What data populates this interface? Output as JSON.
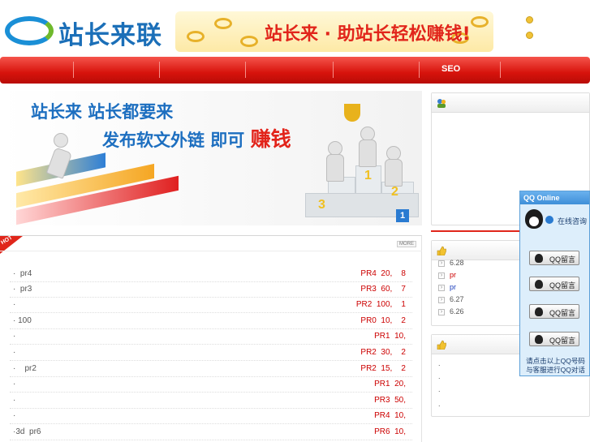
{
  "header": {
    "logo_text": "站长来联盟",
    "banner_text": "站长来 · 助站长轻松赚钱!"
  },
  "nav": {
    "items": [
      "SEO"
    ]
  },
  "hero": {
    "line1": "站长来 站长都要来",
    "line2_prefix": "发布软文外链 即可",
    "line2_highlight": "赚钱",
    "podium_numbers": [
      "1",
      "2",
      "3"
    ],
    "badge": "1"
  },
  "news": {
    "hot_label": "HOT",
    "more_label": "MORE",
    "rows": [
      {
        "left": "·  pr4",
        "right": "PR4  20,    8"
      },
      {
        "left": "·  pr3",
        "right": "PR3  60,    7"
      },
      {
        "left": "·",
        "right": "PR2  100,    1"
      },
      {
        "left": "· 100",
        "right": "PR0  10,    2"
      },
      {
        "left": "·",
        "right": "PR1  10,"
      },
      {
        "left": "·",
        "right": "PR2  30,    2"
      },
      {
        "left": "·    pr2",
        "right": "PR2  15,    2"
      },
      {
        "left": "·",
        "right": "PR1  20,"
      },
      {
        "left": "·",
        "right": "PR3  50,"
      },
      {
        "left": "·",
        "right": "PR4  10,"
      },
      {
        "left": "·3d  pr6",
        "right": "PR6  10,"
      }
    ]
  },
  "right_box2": {
    "items": [
      {
        "text": "6.28",
        "color": "#555555"
      },
      {
        "text": "pr",
        "color": "#cc0000"
      },
      {
        "text": "pr",
        "color": "#1a3dbb"
      },
      {
        "text": "6.27",
        "color": "#555555"
      },
      {
        "text": "6.26",
        "color": "#555555"
      }
    ]
  },
  "right_box3": {
    "items": [
      ".",
      ".",
      ".",
      "."
    ]
  },
  "qq_panel": {
    "title": "QQ Online",
    "consult_label": "在线咨询",
    "button_label": "QQ留言",
    "footer_line1": "请点击以上QQ号码",
    "footer_line2": "与客服进行QQ对话"
  },
  "colors": {
    "nav_red": "#d7130c",
    "accent_blue": "#1d6fc0",
    "price_red": "#cc0000"
  }
}
